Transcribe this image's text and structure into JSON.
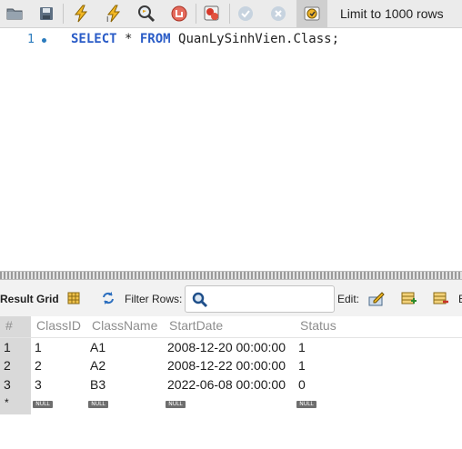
{
  "toolbar": {
    "buttons": [
      {
        "name": "open-folder-icon"
      },
      {
        "name": "save-icon"
      },
      {
        "name": "execute-lightning-icon"
      },
      {
        "name": "execute-current-lightning-icon"
      },
      {
        "name": "explain-magnifier-icon"
      },
      {
        "name": "stop-icon"
      },
      {
        "name": "toggle-error-continue-icon"
      },
      {
        "name": "commit-check-icon"
      },
      {
        "name": "rollback-cancel-icon"
      },
      {
        "name": "auto-commit-toggle-icon"
      }
    ],
    "limit_label": "Limit to 1000 rows"
  },
  "editor": {
    "line_number": "1",
    "code": {
      "kw1": "SELECT",
      "star": " * ",
      "kw2": "FROM",
      "rest": " QuanLySinhVien.Class;"
    }
  },
  "result_toolbar": {
    "result_grid_label": "Result Grid",
    "filter_label": "Filter Rows:",
    "filter_value": "",
    "edit_label": "Edit:"
  },
  "grid": {
    "row_header_label": "#",
    "columns": [
      "ClassID",
      "ClassName",
      "StartDate",
      "Status"
    ],
    "rows": [
      {
        "num": "1",
        "cells": [
          "1",
          "A1",
          "2008-12-20 00:00:00",
          "1"
        ]
      },
      {
        "num": "2",
        "cells": [
          "2",
          "A2",
          "2008-12-22 00:00:00",
          "1"
        ]
      },
      {
        "num": "3",
        "cells": [
          "3",
          "B3",
          "2022-06-08 00:00:00",
          "0"
        ]
      }
    ],
    "new_row_marker": "*",
    "null_label": "NULL"
  },
  "colors": {
    "keyword": "#2a5cc7",
    "line_number": "#2b7bbd",
    "header_text": "#8e8e8e"
  }
}
